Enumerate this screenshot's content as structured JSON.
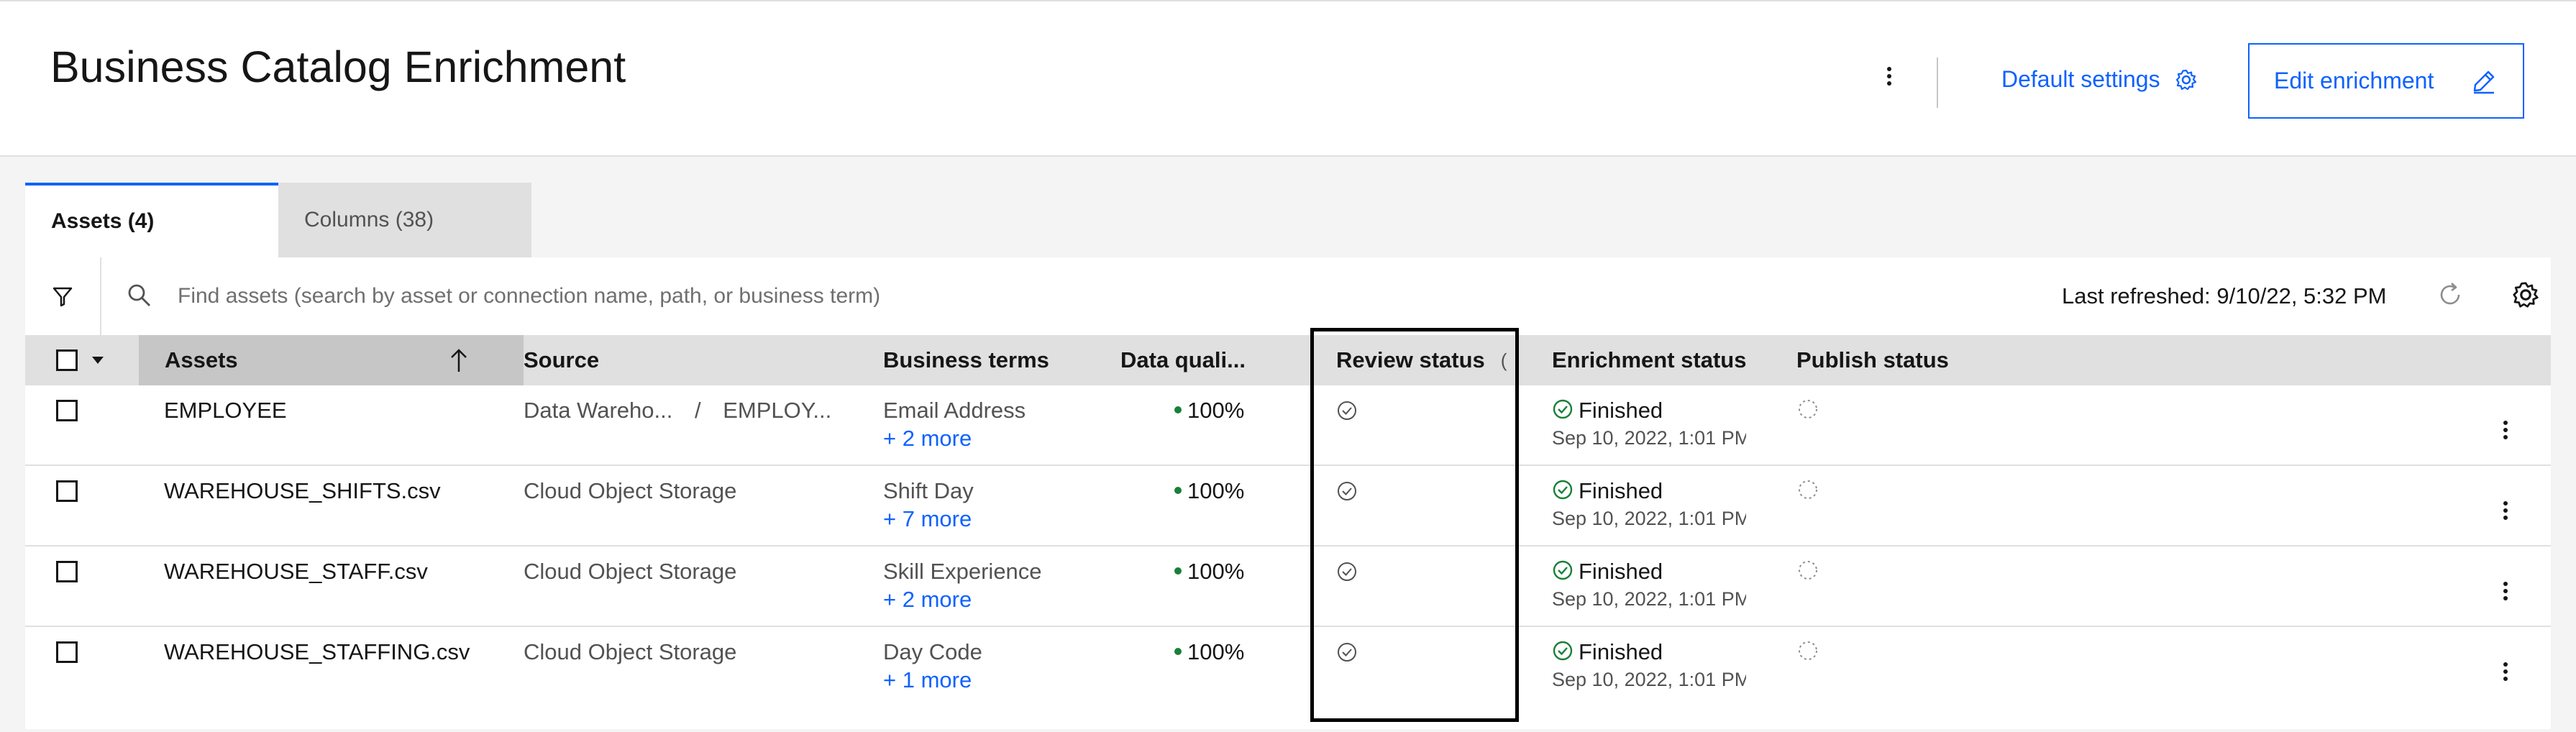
{
  "header": {
    "title": "Business Catalog Enrichment",
    "default_settings_label": "Default settings",
    "edit_enrichment_label": "Edit enrichment"
  },
  "tabs": [
    {
      "label": "Assets (4)",
      "selected": true
    },
    {
      "label": "Columns (38)",
      "selected": false
    }
  ],
  "toolbar": {
    "search_placeholder": "Find assets (search by asset or connection name, path, or business term)",
    "last_refreshed": "Last refreshed: 9/10/22, 5:32 PM"
  },
  "table": {
    "columns": [
      "Assets",
      "Source",
      "Business terms",
      "Data quali...",
      "Review status",
      "Enrichment status",
      "Publish status"
    ],
    "review_status_trailing": "(",
    "rows": [
      {
        "asset": "EMPLOYEE",
        "source_a": "Data Wareho...",
        "source_sep": "/",
        "source_b": "EMPLOY...",
        "term": "Email Address",
        "more": "+ 2 more",
        "quality": "100%",
        "enrichment": "Finished",
        "enrichment_date": "Sep 10, 2022, 1:01 PM"
      },
      {
        "asset": "WAREHOUSE_SHIFTS.csv",
        "source_a": "Cloud Object Storage",
        "term": "Shift Day",
        "more": "+ 7 more",
        "quality": "100%",
        "enrichment": "Finished",
        "enrichment_date": "Sep 10, 2022, 1:01 PM"
      },
      {
        "asset": "WAREHOUSE_STAFF.csv",
        "source_a": "Cloud Object Storage",
        "term": "Skill Experience",
        "more": "+ 2 more",
        "quality": "100%",
        "enrichment": "Finished",
        "enrichment_date": "Sep 10, 2022, 1:01 PM"
      },
      {
        "asset": "WAREHOUSE_STAFFING.csv",
        "source_a": "Cloud Object Storage",
        "term": "Day Code",
        "more": "+ 1 more",
        "quality": "100%",
        "enrichment": "Finished",
        "enrichment_date": "Sep 10, 2022, 1:01 PM"
      }
    ]
  },
  "colors": {
    "accent": "#0f62fe",
    "success": "#198038",
    "header_bg": "#e0e0e0",
    "highlight_box": "#000000"
  },
  "icons": [
    "overflow-menu-icon",
    "gear-icon",
    "pencil-icon",
    "filter-icon",
    "search-icon",
    "refresh-icon",
    "sort-arrow-up-icon",
    "checkmark-outline-icon",
    "checkmark-circle-icon",
    "dashed-circle-icon",
    "chevron-down-icon"
  ]
}
